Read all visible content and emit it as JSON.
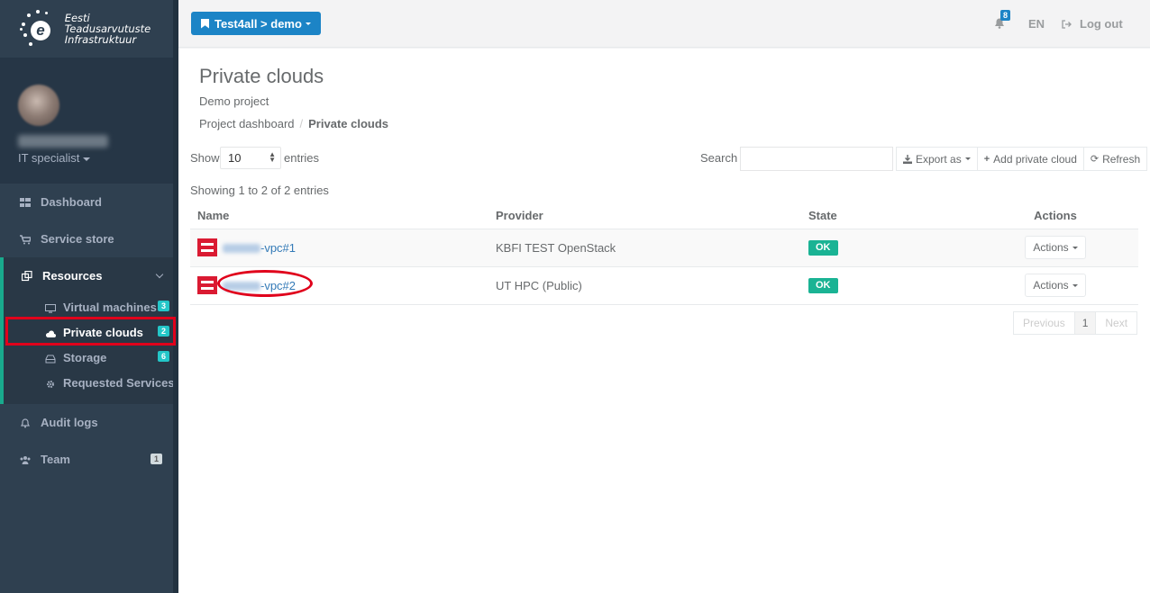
{
  "sidebar": {
    "logo_line1": "Eesti Teadusarvutuste",
    "logo_line2": "Infrastruktuur",
    "logo_letter": "e",
    "profile_role": "IT specialist",
    "items": [
      {
        "label": "Dashboard",
        "icon": "dashboard-icon"
      },
      {
        "label": "Service store",
        "icon": "cart-icon"
      },
      {
        "label": "Resources",
        "icon": "resources-icon"
      },
      {
        "label": "Audit logs",
        "icon": "bell-icon"
      },
      {
        "label": "Team",
        "icon": "team-icon",
        "badge": "1"
      }
    ],
    "resources_sub": [
      {
        "label": "Virtual machines",
        "badge": "3"
      },
      {
        "label": "Private clouds",
        "badge": "2"
      },
      {
        "label": "Storage",
        "badge": "6"
      },
      {
        "label": "Requested Services"
      }
    ]
  },
  "topbar": {
    "project_selector": "Test4all > demo",
    "notification_count": "8",
    "language": "EN",
    "logout_label": "Log out"
  },
  "main": {
    "title": "Private clouds",
    "subtitle": "Demo project",
    "breadcrumb": [
      "Project dashboard",
      "Private clouds"
    ],
    "show_label": "Show",
    "entries_value": "10",
    "entries_label": "entries",
    "search_label": "Search",
    "search_placeholder": "",
    "buttons": {
      "export": "Export as",
      "add": "Add private cloud",
      "refresh": "Refresh"
    },
    "showing_text": "Showing 1 to 2 of 2 entries",
    "table": {
      "headers": [
        "Name",
        "Provider",
        "State",
        "Actions"
      ],
      "rows": [
        {
          "name_suffix": "-vpc#1",
          "provider": "KBFI TEST OpenStack",
          "state": "OK",
          "actions": "Actions"
        },
        {
          "name_suffix": "-vpc#2",
          "provider": "UT HPC (Public)",
          "state": "OK",
          "actions": "Actions"
        }
      ]
    },
    "pagination": {
      "previous": "Previous",
      "page": "1",
      "next": "Next"
    }
  },
  "colors": {
    "sidebar_bg": "#2f4050",
    "accent_green": "#1ab394",
    "primary_blue": "#1c84c6",
    "info_badge": "#23c6c8",
    "annotation_red": "#e0001b",
    "openstack_red": "#da1a32"
  }
}
